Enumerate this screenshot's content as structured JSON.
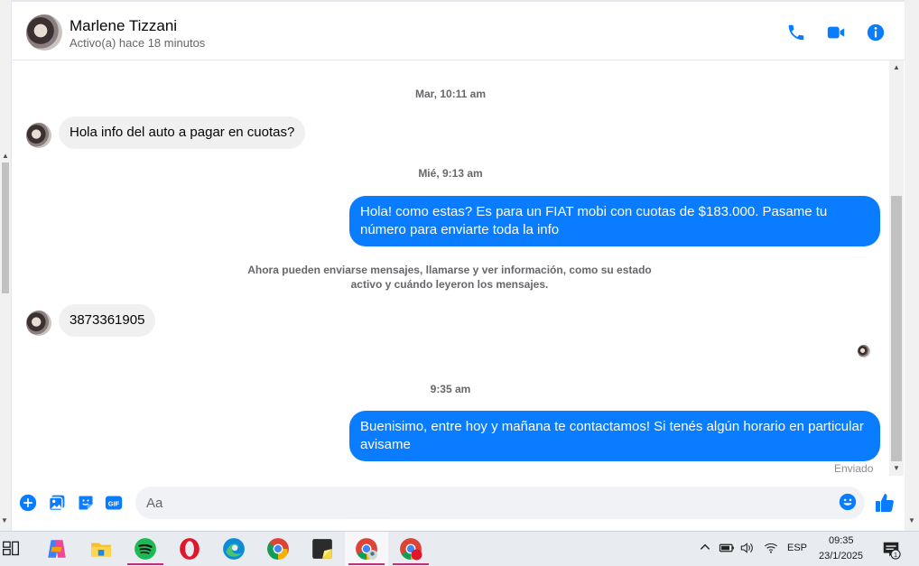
{
  "header": {
    "contact_name": "Marlene Tizzani",
    "contact_status": "Activo(a) hace 18 minutos"
  },
  "messages": {
    "ts1": "Mar, 10:11 am",
    "msg1": "Hola info del auto a pagar en cuotas?",
    "ts2": "Mié, 9:13 am",
    "msg2": "Hola! como estas? Es para un FIAT mobi con cuotas de $183.000. Pasame tu número para enviarte toda la info",
    "system_note": "Ahora pueden enviarse mensajes, llamarse y ver información, como su estado activo y cuándo leyeron los mensajes.",
    "msg3": "3873361905",
    "ts3": "9:35 am",
    "msg4": "Buenisimo, entre hoy y mañana te contactamos! Si tenés algún horario en particular avisame",
    "sent_status": "Enviado"
  },
  "composer": {
    "placeholder": "Aa",
    "gif_label": "GIF"
  },
  "taskbar": {
    "language": "ESP",
    "time": "09:35",
    "date": "23/1/2025",
    "notification_count": "1"
  },
  "colors": {
    "accent": "#0a7cff",
    "incoming_bubble": "#f0f0f0",
    "secondary_text": "#65676b"
  }
}
